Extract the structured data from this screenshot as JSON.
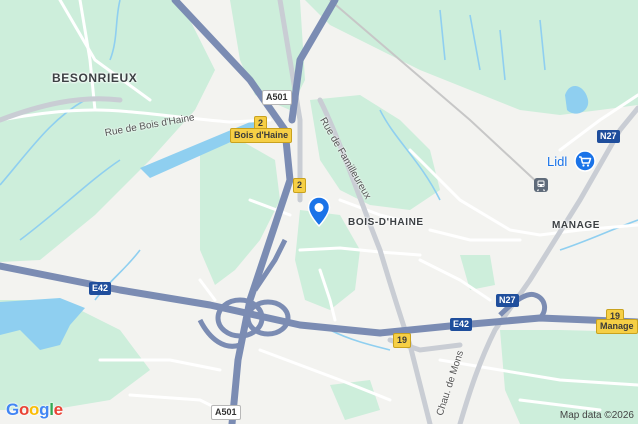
{
  "places": {
    "besonrieux": "BESONRIEUX",
    "bois_dhaine": "BOIS-D'HAINE",
    "manage": "MANAGE"
  },
  "streets": {
    "rue_bois_dhaine": "Rue de Bois d'Haine",
    "rue_familleureux": "Rue de Familleureux",
    "chau_de_mons": "Chau. de Mons"
  },
  "shields": {
    "a501_top": "A501",
    "a501_bottom": "A501",
    "e42_left": "E42",
    "e42_right": "E42",
    "n27_top": "N27",
    "n27_mid": "N27",
    "exit_2_top": "2",
    "exit_bois_dhaine": "Bois d'Haine",
    "exit_2_mid": "2",
    "road_19_mid": "19",
    "road_19_right": "19",
    "exit_manage": "Manage"
  },
  "poi": {
    "lidl": "Lidl",
    "lidl_icon": "shopping-cart-icon",
    "train_icon": "train-station-icon",
    "pin_icon": "location-pin-icon"
  },
  "logo": {
    "letters": [
      "G",
      "o",
      "o",
      "g",
      "l",
      "e"
    ],
    "colors": [
      "#4285F4",
      "#EA4335",
      "#FBBC05",
      "#4285F4",
      "#34A853",
      "#EA4335"
    ]
  },
  "attribution": "Map data ©2026",
  "colors": {
    "highway": "#7b8cb3",
    "green": "#cdeedb",
    "water": "#8fcff0",
    "pin": "#1a73e8"
  }
}
